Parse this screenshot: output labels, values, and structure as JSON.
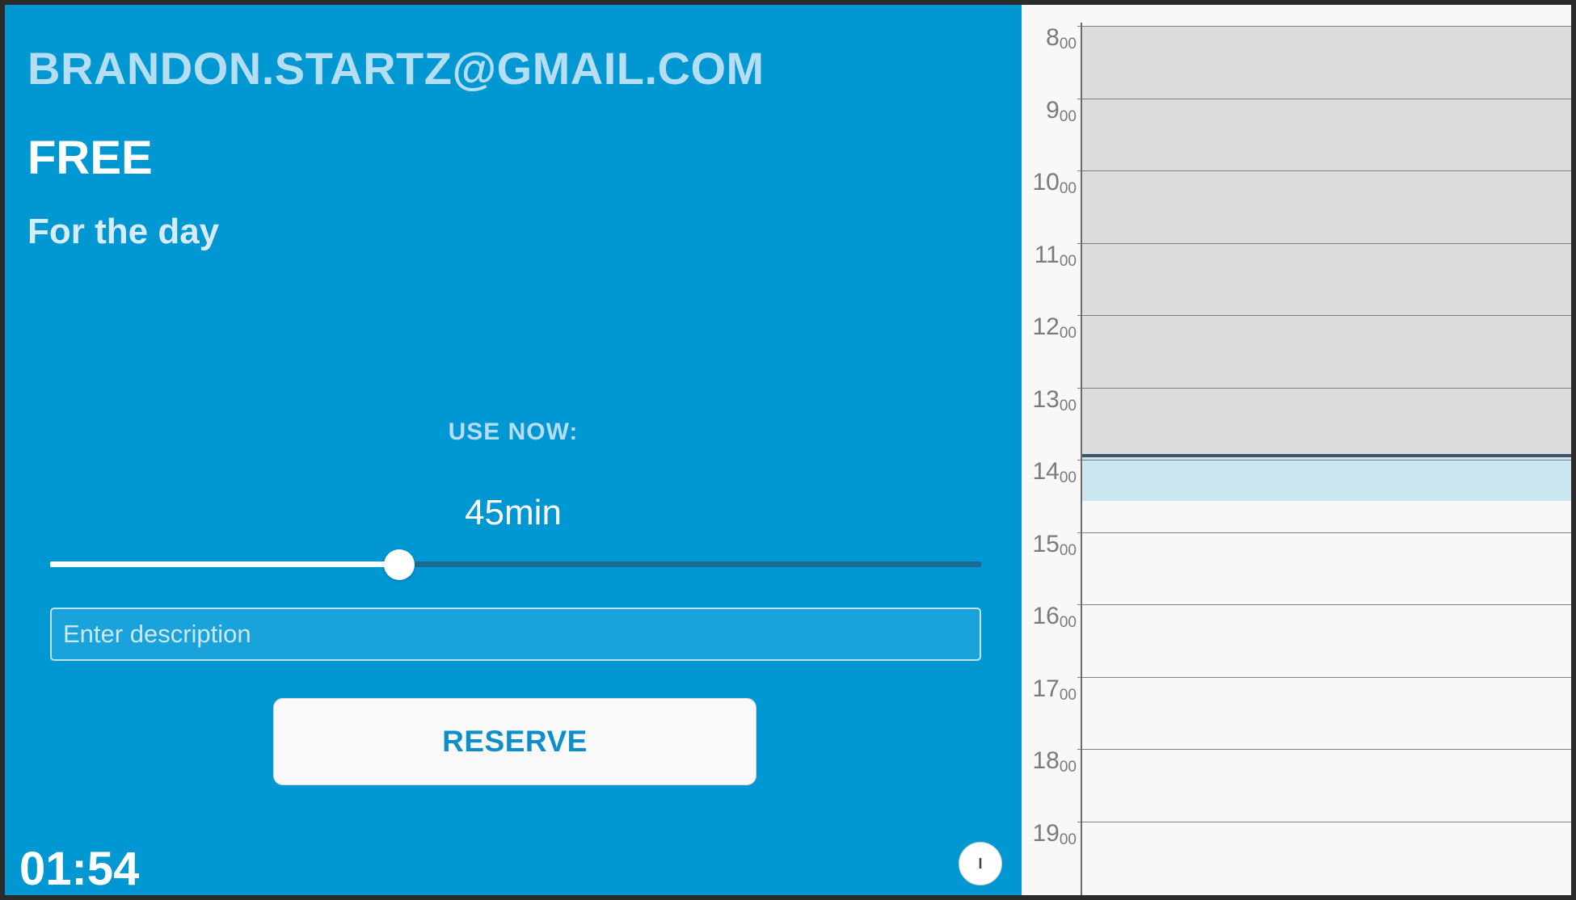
{
  "room": {
    "title": "BRANDON.STARTZ@GMAIL.COM"
  },
  "status": {
    "label": "FREE",
    "detail": "For the day"
  },
  "use_now": {
    "label": "USE NOW:",
    "duration": "45min",
    "slider_fraction": 0.375
  },
  "description": {
    "placeholder": "Enter description",
    "value": ""
  },
  "reserve": {
    "label": "RESERVE"
  },
  "clock": {
    "time": "01:54"
  },
  "info": {
    "icon": "info-icon",
    "label": "I"
  },
  "calendar": {
    "hours": [
      {
        "h": "8",
        "m": "00"
      },
      {
        "h": "9",
        "m": "00"
      },
      {
        "h": "10",
        "m": "00"
      },
      {
        "h": "11",
        "m": "00"
      },
      {
        "h": "12",
        "m": "00"
      },
      {
        "h": "13",
        "m": "00"
      },
      {
        "h": "14",
        "m": "00"
      },
      {
        "h": "15",
        "m": "00"
      },
      {
        "h": "16",
        "m": "00"
      },
      {
        "h": "17",
        "m": "00"
      },
      {
        "h": "18",
        "m": "00"
      },
      {
        "h": "19",
        "m": "00"
      }
    ],
    "busy_color": "#dcdcdc",
    "reservation_color": "#cae6f0",
    "now_line_color": "#3d5568"
  },
  "colors": {
    "panel_blue": "#0097d3",
    "accent_text": "#0f8fca",
    "calendar_bg": "#f8f8f8"
  }
}
